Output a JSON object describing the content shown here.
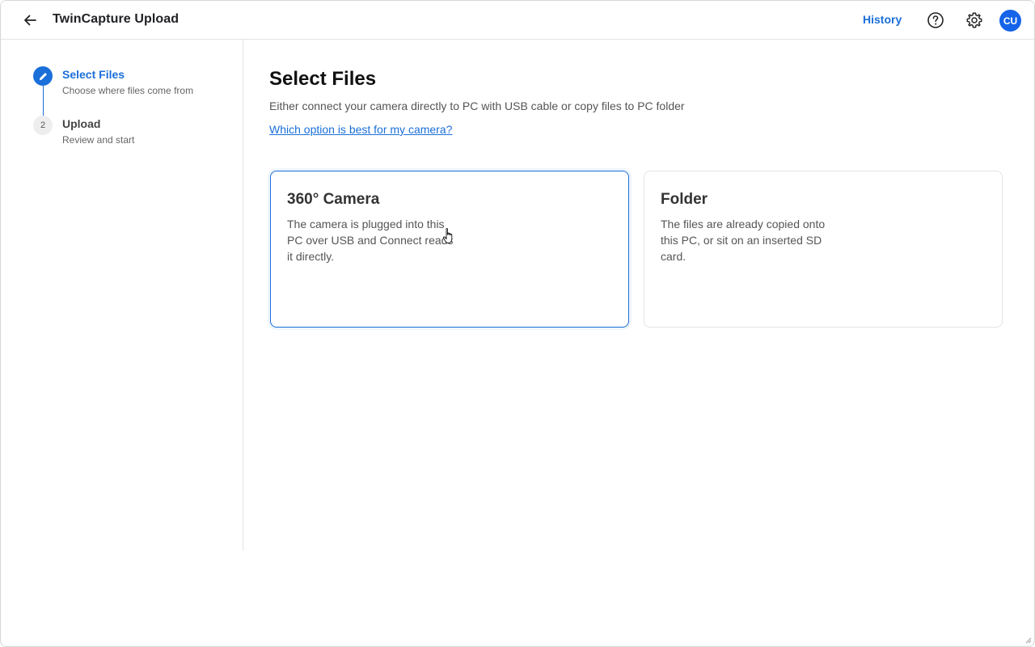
{
  "header": {
    "title": "TwinCapture Upload",
    "history_label": "History",
    "avatar_initials": "CU",
    "icons": {
      "back": "arrow-left-icon",
      "help": "question-circle-icon",
      "settings": "gear-icon"
    }
  },
  "stepper": {
    "steps": [
      {
        "number": "1",
        "title": "Select Files",
        "subtitle": "Choose where files come from",
        "state": "active",
        "icon": "pencil-icon"
      },
      {
        "number": "2",
        "title": "Upload",
        "subtitle": "Review and start",
        "state": "inactive"
      }
    ]
  },
  "main": {
    "title": "Select Files",
    "description": "Either connect your camera directly to PC with USB cable or copy files to PC folder",
    "help_link": "Which option is best for my camera?",
    "options": [
      {
        "title": "360° Camera",
        "description": "The camera is plugged into this PC over USB and Connect reads it directly.",
        "selected": true
      },
      {
        "title": "Folder",
        "description": "The files are already copied onto this PC, or sit on an inserted SD card.",
        "selected": false
      }
    ]
  },
  "colors": {
    "accent": "#1a6fd9",
    "avatar_bg": "#1463e8",
    "border": "#e3e3e3"
  }
}
